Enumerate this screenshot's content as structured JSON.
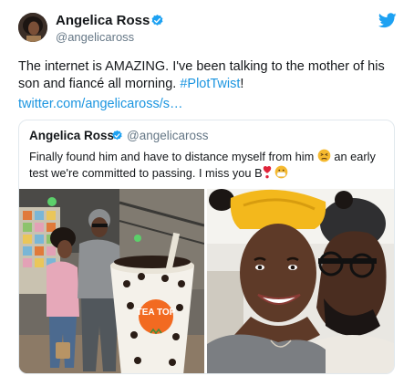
{
  "author": {
    "name": "Angelica Ross",
    "handle": "@angelicaross"
  },
  "tweet": {
    "text_before_hashtag": "The internet is AMAZING.  I've been talking to the mother of his son and fiancé all morning.  ",
    "hashtag": "#PlotTwist",
    "text_after_hashtag": "!",
    "link": "twitter.com/angelicaross/s…"
  },
  "quoted_tweet": {
    "name": "Angelica Ross",
    "handle": "@angelicaross",
    "text_part1": "Finally found him and have to distance myself from him",
    "text_part2": " an early test we're committed to passing.  I miss you B",
    "cup_sign": "TEA TOP"
  },
  "icons": {
    "verified": "verified-badge-icon",
    "bird": "twitter-bird-icon",
    "emoji1": "persevering-face-emoji",
    "emoji2": "heart-exclamation-emoji",
    "emoji3": "face-with-mask-emoji"
  },
  "colors": {
    "accent": "#1da1f2",
    "link": "#1b95e0",
    "muted": "#657786",
    "border": "#e1e8ed",
    "cup_badge": "#f26a21"
  }
}
